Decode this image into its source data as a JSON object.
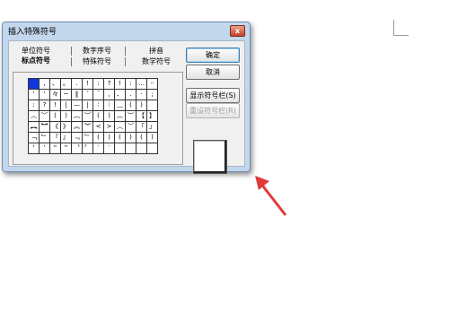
{
  "dialog": {
    "title": "插入特殊符号",
    "close_glyph": "x",
    "tabs_row1": [
      "单位符号",
      "数字序号",
      "拼音"
    ],
    "tabs_row2": [
      "标点符号",
      "特殊符号",
      "数学符号"
    ],
    "buttons": {
      "ok": "确定",
      "cancel": "取消",
      "show_toolbar": "显示符号栏(S)",
      "reset_toolbar": "重设符号栏(R)"
    },
    "symbols": [
      [
        "",
        ",",
        "、",
        "。",
        ".",
        "!",
        ":",
        "?",
        "!",
        ":",
        "…",
        "··"
      ],
      [
        "'",
        "'",
        "々",
        "~",
        "‖",
        "ˇ",
        "ˉ",
        ",",
        "、",
        ".",
        "·",
        ";"
      ],
      [
        ":",
        "?",
        "!",
        "|",
        "—",
        "|",
        "∶",
        "︱",
        "﹏",
        "(",
        ")",
        ""
      ],
      [
        "︿",
        "﹀",
        "(",
        ")",
        "︹",
        "︺",
        "(",
        ")",
        "︵",
        "︶",
        "【",
        "】"
      ],
      [
        "︻",
        "︼",
        "《",
        "》",
        "︽",
        "︾",
        "<",
        ">",
        "︿",
        "﹀",
        "「",
        "」"
      ],
      [
        "﹁",
        "﹂",
        "『",
        "』",
        "﹃",
        "﹄",
        "(",
        ")",
        "(",
        ")",
        "(",
        ")"
      ],
      [
        "‘",
        "’",
        "“",
        "”",
        "〝",
        "〞",
        "‵",
        "′",
        "",
        "",
        "",
        ""
      ]
    ]
  },
  "colors": {
    "selection": "#1136e0",
    "arrow": "#e03a3a",
    "dialog_frame": "#c2d6ec"
  }
}
